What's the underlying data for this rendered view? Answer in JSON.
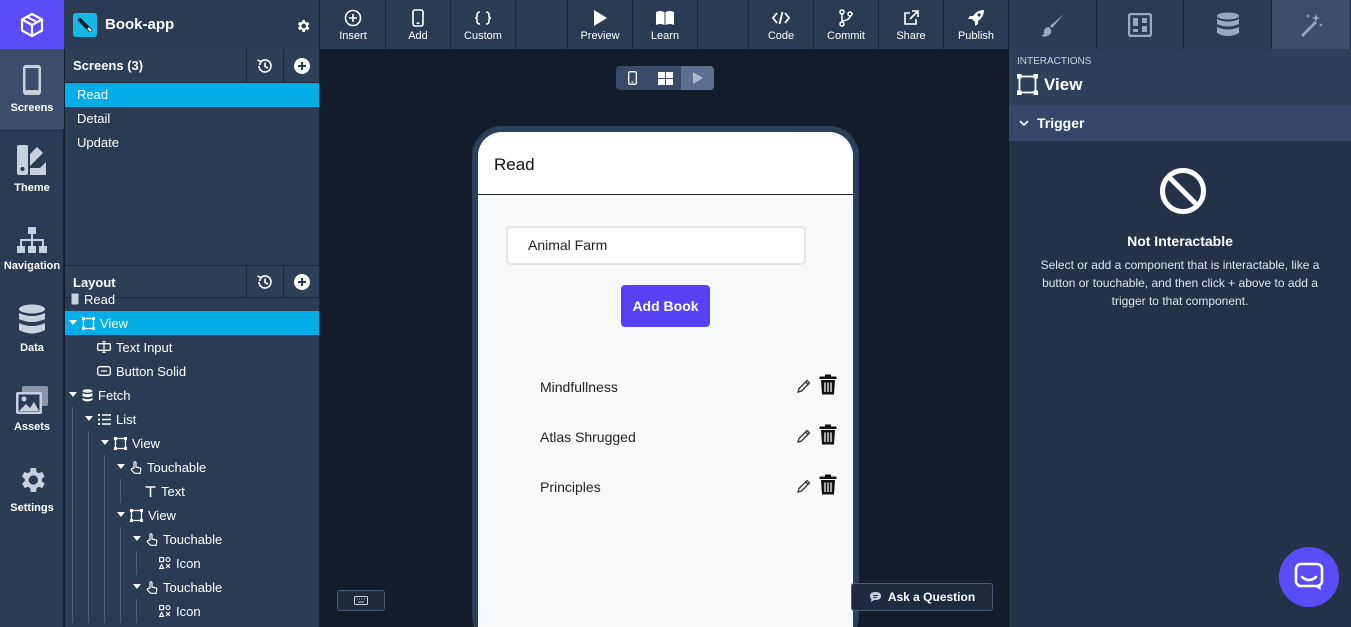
{
  "app": {
    "name": "Book-app"
  },
  "toolbar": {
    "insert": "Insert",
    "add": "Add",
    "custom": "Custom",
    "preview": "Preview",
    "learn": "Learn",
    "code": "Code",
    "commit": "Commit",
    "share": "Share",
    "publish": "Publish"
  },
  "right_tabs": [
    "brush-icon",
    "layout-icon",
    "database-icon",
    "magic-wand-icon"
  ],
  "leftnav": {
    "screens": "Screens",
    "theme": "Theme",
    "navigation": "Navigation",
    "data": "Data",
    "assets": "Assets",
    "settings": "Settings"
  },
  "screens_panel": {
    "title": "Screens (3)",
    "items": [
      "Read",
      "Detail",
      "Update"
    ],
    "selected": "Read"
  },
  "layout_panel": {
    "title": "Layout",
    "tree": [
      {
        "label": "Read",
        "icon": "phone-icon"
      },
      {
        "label": "View",
        "icon": "view-icon",
        "selected": true
      },
      {
        "label": "Text Input",
        "icon": "text-input-icon"
      },
      {
        "label": "Button Solid",
        "icon": "button-icon"
      },
      {
        "label": "Fetch",
        "icon": "database-icon"
      },
      {
        "label": "List",
        "icon": "list-icon"
      },
      {
        "label": "View",
        "icon": "view-icon"
      },
      {
        "label": "Touchable",
        "icon": "touch-icon"
      },
      {
        "label": "Text",
        "icon": "text-icon"
      },
      {
        "label": "View",
        "icon": "view-icon"
      },
      {
        "label": "Touchable",
        "icon": "touch-icon"
      },
      {
        "label": "Icon",
        "icon": "icon-icon"
      },
      {
        "label": "Touchable",
        "icon": "touch-icon"
      },
      {
        "label": "Icon",
        "icon": "icon-icon"
      }
    ]
  },
  "canvas": {
    "screen_title": "Read",
    "input_value": "Animal Farm",
    "add_button": "Add Book",
    "books": [
      "Mindfullness",
      "Atlas Shrugged",
      "Principles"
    ],
    "ask_button": "Ask a Question"
  },
  "inspector": {
    "section_label": "INTERACTIONS",
    "component": "View",
    "trigger_label": "Trigger",
    "empty_title": "Not Interactable",
    "empty_desc": "Select or add a component that is interactable, like a button or touchable, and then click + above to add a trigger to that component."
  },
  "colors": {
    "accent": "#5a4cf6",
    "selected": "#05ade8",
    "panel": "#2b3a55",
    "canvas": "#141c2b"
  }
}
